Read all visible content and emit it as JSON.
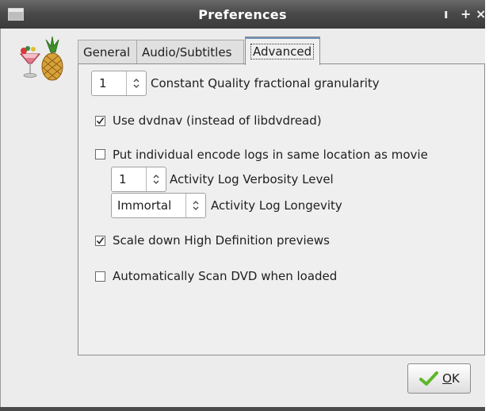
{
  "window": {
    "title": "Preferences",
    "controls": {
      "minimize": "ı",
      "maximize": "+",
      "close": "×"
    }
  },
  "tabs": [
    {
      "label": "General",
      "active": false
    },
    {
      "label": "Audio/Subtitles",
      "active": false
    },
    {
      "label": "Advanced",
      "active": true
    }
  ],
  "advanced": {
    "quality_granularity": {
      "value": "1",
      "label": "Constant Quality fractional granularity"
    },
    "use_dvdnav": {
      "checked": true,
      "label": "Use dvdnav (instead of libdvdread)"
    },
    "individual_logs": {
      "checked": false,
      "label": "Put individual encode logs in same location as movie"
    },
    "log_verbosity": {
      "value": "1",
      "label": "Activity Log Verbosity Level"
    },
    "log_longevity": {
      "value": "Immortal",
      "label": "Activity Log Longevity"
    },
    "scale_down_hd": {
      "checked": true,
      "label": "Scale down High Definition previews"
    },
    "auto_scan_dvd": {
      "checked": false,
      "label": "Automatically Scan DVD when loaded"
    }
  },
  "buttons": {
    "ok": "OK"
  },
  "icons": {
    "app": "handbrake-pineapple-icon",
    "ok": "check-icon",
    "spin": "spin-arrows-icon"
  },
  "colors": {
    "titlebar": "#4a4a4a",
    "check_green": "#5cb82a",
    "tab_highlight": "#6e8fb8"
  }
}
